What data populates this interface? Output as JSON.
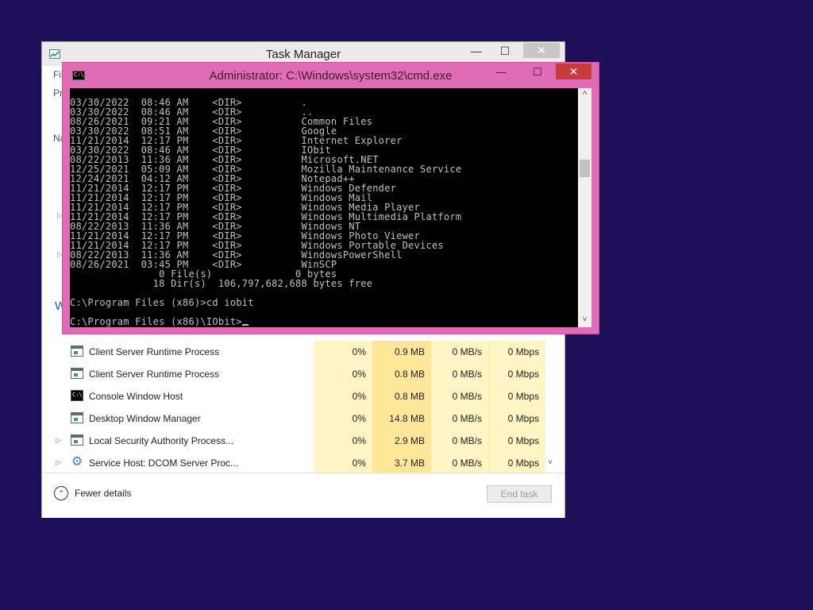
{
  "colors": {
    "desktop": "#1e0f59",
    "cmd_frame": "#e06bb6",
    "cmd_close": "#c73b3b",
    "console_bg": "#000000",
    "console_text": "#c0c0c0",
    "heat_light": "#fff4c4",
    "heat_memory": "#ffe79a"
  },
  "task_manager": {
    "title": "Task Manager",
    "minimize": "—",
    "maximize": "☐",
    "close": "✕",
    "peek_labels": {
      "menu": "Fil",
      "tab": "Pr",
      "column": "Na",
      "group": "W"
    },
    "processes": [
      {
        "name": "Client Server Runtime Process",
        "icon": "window-icon",
        "expander": "",
        "cpu": "0%",
        "memory": "0.9 MB",
        "disk": "0 MB/s",
        "network": "0 Mbps"
      },
      {
        "name": "Client Server Runtime Process",
        "icon": "window-icon",
        "expander": "",
        "cpu": "0%",
        "memory": "0.8 MB",
        "disk": "0 MB/s",
        "network": "0 Mbps"
      },
      {
        "name": "Console Window Host",
        "icon": "console-icon",
        "expander": "",
        "cpu": "0%",
        "memory": "0.8 MB",
        "disk": "0 MB/s",
        "network": "0 Mbps"
      },
      {
        "name": "Desktop Window Manager",
        "icon": "window-icon",
        "expander": "",
        "cpu": "0%",
        "memory": "14.8 MB",
        "disk": "0 MB/s",
        "network": "0 Mbps"
      },
      {
        "name": "Local Security Authority Process...",
        "icon": "window-icon",
        "expander": "▷",
        "cpu": "0%",
        "memory": "2.9 MB",
        "disk": "0 MB/s",
        "network": "0 Mbps"
      },
      {
        "name": "Service Host: DCOM Server Proc...",
        "icon": "gear-icon",
        "expander": "▷",
        "cpu": "0%",
        "memory": "3.7 MB",
        "disk": "0 MB/s",
        "network": "0 Mbps"
      }
    ],
    "fewer_details_label": "Fewer details",
    "end_task_label": "End task"
  },
  "cmd": {
    "title": "Administrator: C:\\Windows\\system32\\cmd.exe",
    "minimize": "—",
    "maximize": "☐",
    "close": "✕",
    "lines": [
      "03/30/2022  08:46 AM    <DIR>          .",
      "03/30/2022  08:46 AM    <DIR>          ..",
      "08/26/2021  09:21 AM    <DIR>          Common Files",
      "03/30/2022  08:51 AM    <DIR>          Google",
      "11/21/2014  12:17 PM    <DIR>          Internet Explorer",
      "03/30/2022  08:46 AM    <DIR>          IObit",
      "08/22/2013  11:36 AM    <DIR>          Microsoft.NET",
      "12/25/2021  05:09 AM    <DIR>          Mozilla Maintenance Service",
      "12/24/2021  04:12 AM    <DIR>          Notepad++",
      "11/21/2014  12:17 PM    <DIR>          Windows Defender",
      "11/21/2014  12:17 PM    <DIR>          Windows Mail",
      "11/21/2014  12:17 PM    <DIR>          Windows Media Player",
      "11/21/2014  12:17 PM    <DIR>          Windows Multimedia Platform",
      "08/22/2013  11:36 AM    <DIR>          Windows NT",
      "11/21/2014  12:17 PM    <DIR>          Windows Photo Viewer",
      "11/21/2014  12:17 PM    <DIR>          Windows Portable Devices",
      "08/22/2013  11:36 AM    <DIR>          WindowsPowerShell",
      "08/26/2021  03:45 PM    <DIR>          WinSCP",
      "               0 File(s)              0 bytes",
      "              18 Dir(s)  106,797,682,688 bytes free",
      "",
      "C:\\Program Files (x86)>cd iobit",
      ""
    ],
    "prompt": "C:\\Program Files (x86)\\IObit>"
  }
}
